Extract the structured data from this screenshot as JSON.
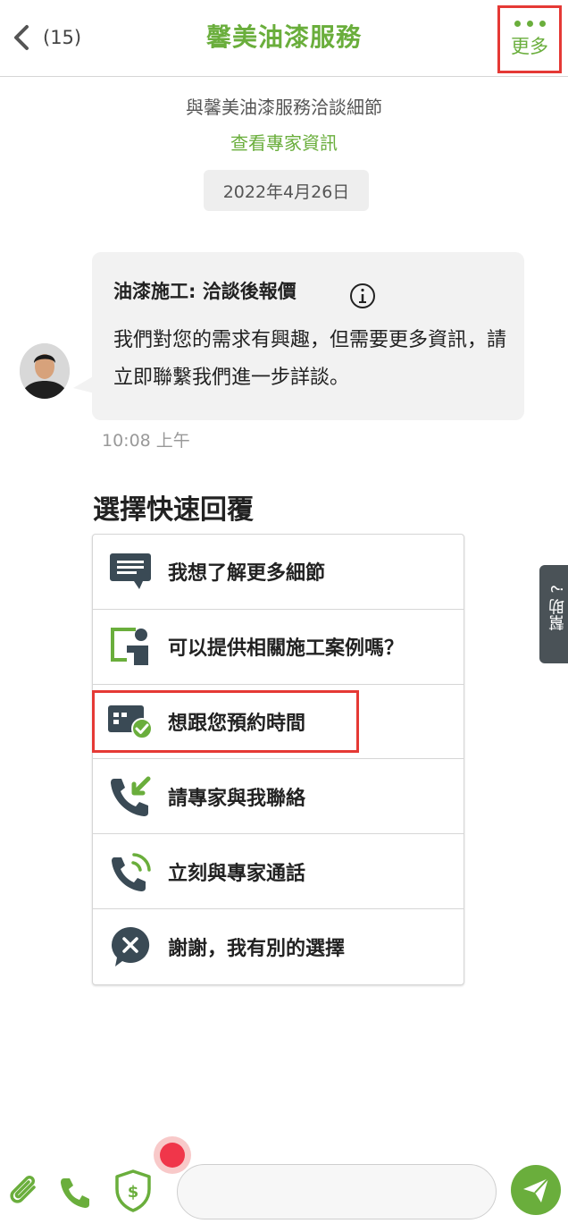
{
  "header": {
    "back_count": "(15)",
    "title": "馨美油漆服務",
    "more_label": "更多"
  },
  "intro": {
    "subtitle": "與馨美油漆服務洽談細節",
    "expert_link": "查看專家資訊",
    "date": "2022年4月26日"
  },
  "message": {
    "title": "油漆施工: 洽談後報價",
    "body": "我們對您的需求有興趣，但需要更多資訊，請立即聯繫我們進一步詳談。",
    "time": "10:08 上午"
  },
  "quick_replies": {
    "heading": "選擇快速回覆",
    "items": [
      {
        "label": "我想了解更多細節",
        "icon": "message-icon"
      },
      {
        "label": "可以提供相關施工案例嗎？",
        "icon": "presentation-icon"
      },
      {
        "label": "想跟您預約時間",
        "icon": "calendar-check-icon"
      },
      {
        "label": "請專家與我聯絡",
        "icon": "incoming-call-icon"
      },
      {
        "label": "立刻與專家通話",
        "icon": "phone-ringing-icon"
      },
      {
        "label": "謝謝，我有別的選擇",
        "icon": "close-bubble-icon"
      }
    ]
  },
  "help_tab": {
    "label": "幫助 ?"
  },
  "composer": {
    "placeholder": ""
  },
  "colors": {
    "brand": "#6aae3c",
    "icon_dark": "#3a4a55",
    "highlight": "#e53935"
  }
}
